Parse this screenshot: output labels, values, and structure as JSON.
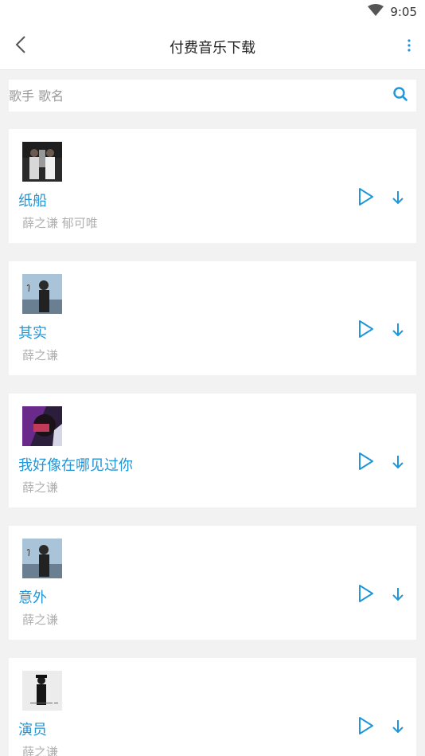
{
  "status_bar": {
    "time": "9:05"
  },
  "header": {
    "title": "付费音乐下载"
  },
  "search": {
    "placeholder": "歌手 歌名",
    "value": ""
  },
  "colors": {
    "accent": "#2196d8",
    "muted": "#b0b0b0",
    "background": "#f2f2f2"
  },
  "icons": {
    "back": "chevron-left-icon",
    "more": "more-vert-icon",
    "search": "search-icon",
    "play": "play-icon",
    "download": "download-icon",
    "wifi": "wifi-icon"
  },
  "songs": [
    {
      "title": "纸船",
      "singer": "薛之谦 郁可唯"
    },
    {
      "title": "其实",
      "singer": "薛之谦"
    },
    {
      "title": "我好像在哪见过你",
      "singer": "薛之谦"
    },
    {
      "title": "意外",
      "singer": "薛之谦"
    },
    {
      "title": "演员",
      "singer": "薛之谦"
    }
  ]
}
